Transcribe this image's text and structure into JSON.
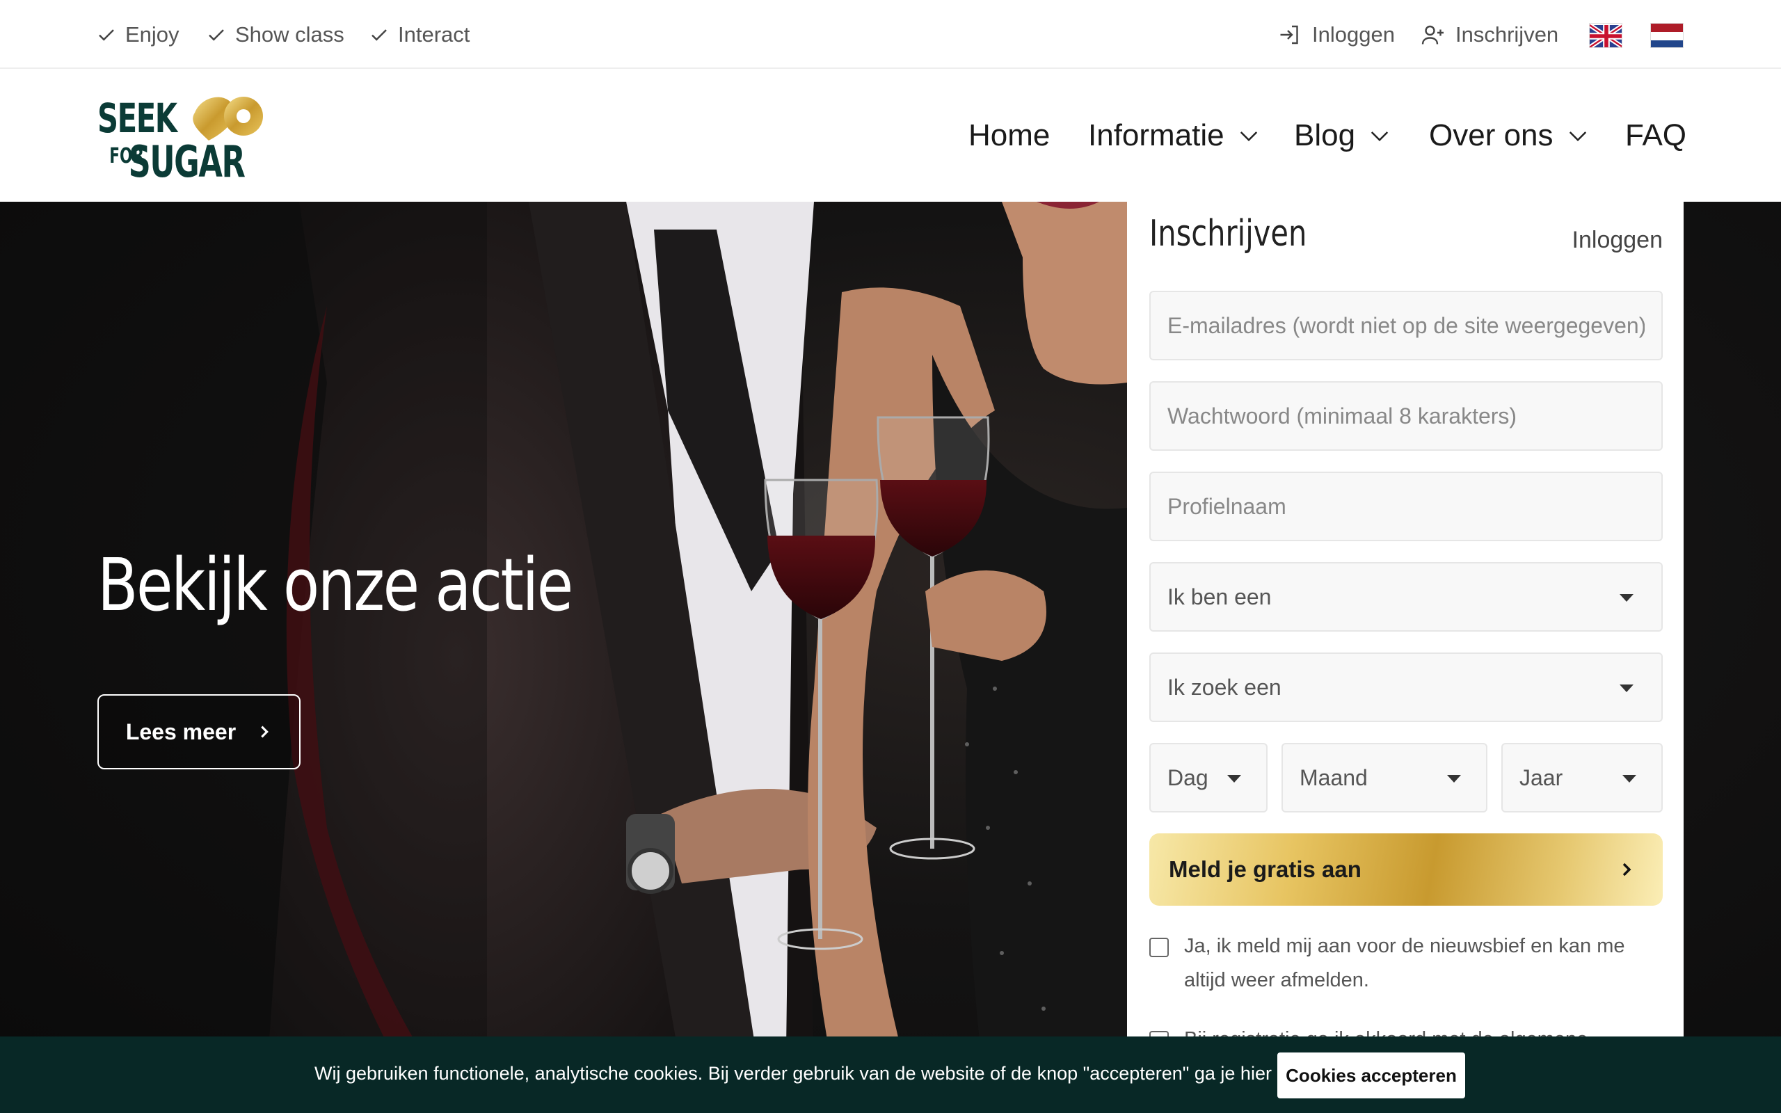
{
  "topbar": {
    "perks": [
      "Enjoy",
      "Show class",
      "Interact"
    ],
    "login_label": "Inloggen",
    "register_label": "Inschrijven"
  },
  "languages": [
    "english-flag",
    "dutch-flag"
  ],
  "logo": {
    "line1": "SEEK",
    "line2_small": "FOR",
    "line2": "SUGAR"
  },
  "nav": {
    "home": "Home",
    "info": "Informatie",
    "blog": "Blog",
    "about": "Over ons",
    "faq": "FAQ"
  },
  "hero": {
    "title": "Bekijk onze actie",
    "button": "Lees meer"
  },
  "signup": {
    "title": "Inschrijven",
    "login_link": "Inloggen",
    "email_placeholder": "E-mailadres (wordt niet op de site weergegeven)",
    "password_placeholder": "Wachtwoord (minimaal 8 karakters)",
    "profile_placeholder": "Profielnaam",
    "i_am": "Ik ben een",
    "looking_for": "Ik zoek een",
    "day": "Dag",
    "month": "Maand",
    "year": "Jaar",
    "submit": "Meld je gratis aan",
    "newsletter": "Ja, ik meld mij aan voor de nieuwsbief en kan me altijd weer afmelden.",
    "terms": "Bij registratie ga ik akkoord met de algemene"
  },
  "cookie": {
    "text": "Wij gebruiken functionele, analytische cookies. Bij verder gebruik van de website of de knop \"accepteren\" ga je hier mee akkoord.",
    "button": "Cookies accepteren"
  },
  "colors": {
    "brand_dark": "#0b3b36",
    "brand_gold": "#d4a93c",
    "cookie_bg": "#082826"
  }
}
